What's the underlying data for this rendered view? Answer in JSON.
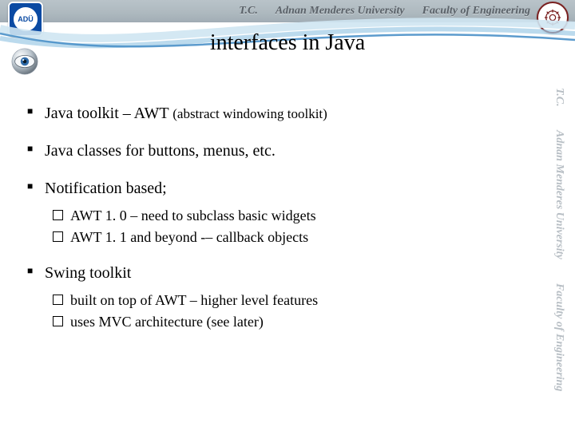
{
  "header": {
    "tc": "T.C.",
    "university": "Adnan Menderes University",
    "faculty": "Faculty of Engineering",
    "logo_left_text": "ADÜ"
  },
  "watermark": {
    "tc": "T.C.",
    "university": "Adnan Menderes University",
    "faculty": "Faculty of Engineering"
  },
  "title": "interfaces in Java",
  "bullets": {
    "b1_main": "Java toolkit – AWT ",
    "b1_paren": "(abstract windowing toolkit)",
    "b2": "Java classes for buttons, menus, etc.",
    "b3": "Notification based;",
    "b3_s1": "AWT 1. 0 – need to subclass basic widgets",
    "b3_s2": "AWT 1. 1 and beyond -– callback objects",
    "b4": "Swing toolkit",
    "b4_s1": "built on top of AWT – higher level features",
    "b4_s2": "uses MVC architecture (see later)"
  }
}
